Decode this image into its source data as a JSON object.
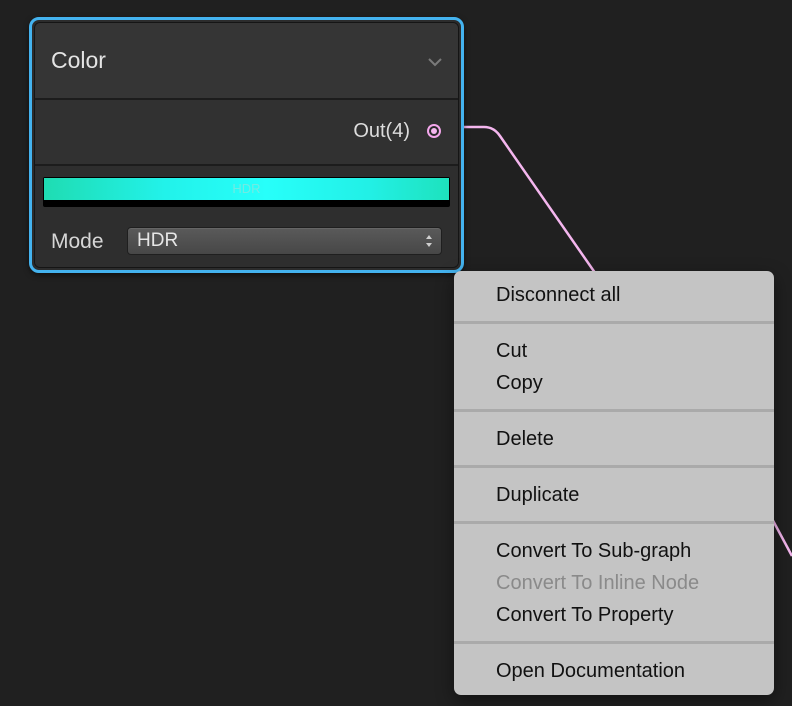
{
  "node": {
    "title": "Color",
    "output_port_label": "Out(4)",
    "swatch_label": "HDR",
    "mode_label": "Mode",
    "mode_value": "HDR"
  },
  "colors": {
    "selection_border": "#44b3ef",
    "edge": "#f4b6ee",
    "swatch_color": "#22f2ea",
    "background": "#202020",
    "menu_background": "#c4c4c4"
  },
  "context_menu": {
    "items": [
      {
        "label": "Disconnect all",
        "enabled": true
      },
      {
        "label": "Cut",
        "enabled": true
      },
      {
        "label": "Copy",
        "enabled": true
      },
      {
        "label": "Delete",
        "enabled": true
      },
      {
        "label": "Duplicate",
        "enabled": true
      },
      {
        "label": "Convert To Sub-graph",
        "enabled": true
      },
      {
        "label": "Convert To Inline Node",
        "enabled": false
      },
      {
        "label": "Convert To Property",
        "enabled": true
      },
      {
        "label": "Open Documentation",
        "enabled": true
      }
    ]
  },
  "icons": {
    "collapse": "chevron-down-icon",
    "port": "port-connector-icon",
    "select_arrows": "up-down-arrows-icon"
  }
}
